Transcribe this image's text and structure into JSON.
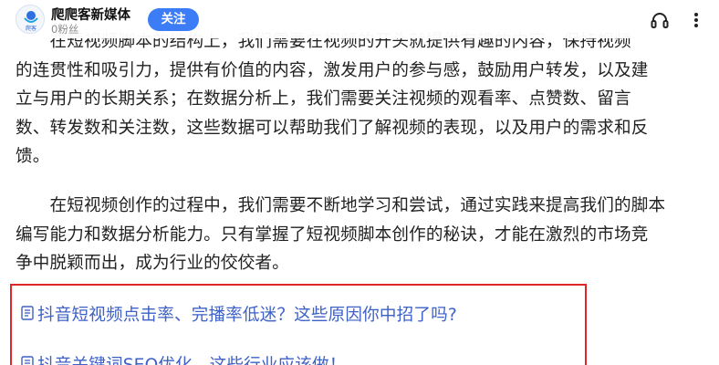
{
  "header": {
    "author_name": "爬爬客新媒体",
    "fans_label": "0粉丝",
    "follow_label": "关注",
    "avatar_text": "爬客",
    "icons": [
      "headphones-icon",
      "more-options-icon"
    ]
  },
  "article": {
    "paragraphs": [
      {
        "lines": [
          "　　在短视频脚本的结构上，我们需要在视频的开头就提供有趣的内容，保持视频",
          "的连贯性和吸引力，提供有价值的内容，激发用户的参与感，鼓励用户转发，以及建",
          "立与用户的长期关系；在数据分析上，我们需要关注视频的观看率、点赞数、留言",
          "数、转发数和关注数，这些数据可以帮助我们了解视频的表现，以及用户的需求和反",
          "馈。"
        ]
      },
      {
        "lines": [
          "　　在短视频创作的过程中，我们需要不断地学习和尝试，通过实践来提高我们的脚本",
          "编写能力和数据分析能力。只有掌握了短视频脚本创作的秘诀，才能在激烈的市场竞",
          "争中脱颖而出，成为行业的佼佼者。"
        ]
      }
    ]
  },
  "related": {
    "highlight_color": "#e0252b",
    "link_color": "#3d61c6",
    "items": [
      {
        "icon": "document-icon",
        "text": "抖音短视频点击率、完播率低迷？这些原因你中招了吗?"
      },
      {
        "icon": "document-icon",
        "text": "抖音关键词SEO优化，这些行业应该做！"
      }
    ]
  },
  "colors": {
    "accent": "#3c7cf6",
    "body_text": "#222222",
    "muted_text": "#8a8a8a"
  }
}
